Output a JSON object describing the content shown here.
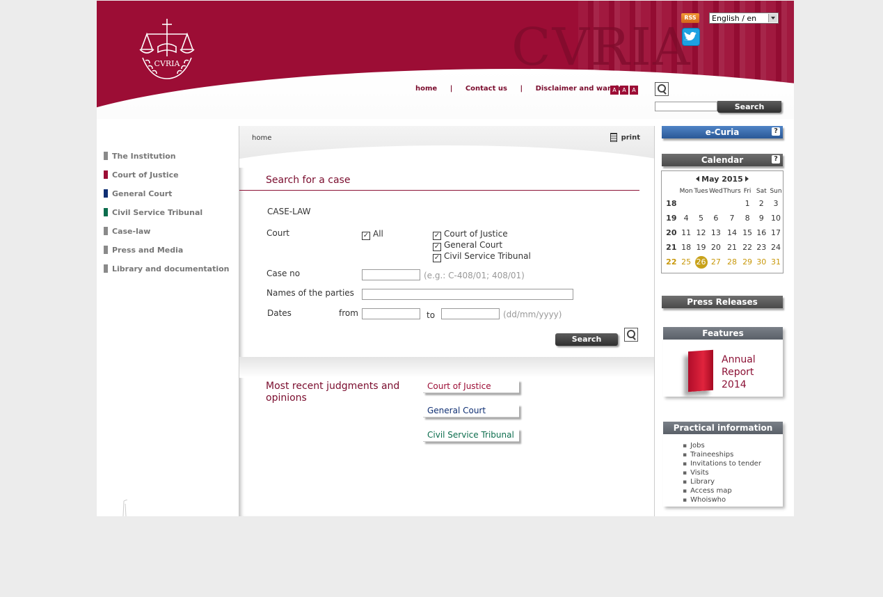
{
  "header": {
    "logo_text": "CVRIA",
    "brand_text": "CVRIA",
    "rss_label": "RSS",
    "language": "English / en",
    "links": [
      "home",
      "Contact us",
      "Disclaimer and warning"
    ],
    "font_size_labels": [
      "A",
      "A",
      "A"
    ],
    "search_button": "Search"
  },
  "left_nav": [
    {
      "label": "The Institution",
      "color": "#8a8a8a"
    },
    {
      "label": "Court of Justice",
      "color": "#9c0d35"
    },
    {
      "label": "General Court",
      "color": "#0f2f73"
    },
    {
      "label": "Civil Service Tribunal",
      "color": "#0c6d4d"
    },
    {
      "label": "Case-law",
      "color": "#8a8a8a"
    },
    {
      "label": "Press and Media",
      "color": "#8a8a8a"
    },
    {
      "label": "Library and documentation",
      "color": "#8a8a8a"
    }
  ],
  "breadcrumb": "home",
  "print_label": "print",
  "search_form": {
    "title": "Search for a case",
    "section": "CASE-LAW",
    "court_label": "Court",
    "court_all": "All",
    "courts": [
      "Court of Justice",
      "General Court",
      "Civil Service Tribunal"
    ],
    "case_no_label": "Case no",
    "case_no_hint": "(e.g.: C-408/01; 408/01)",
    "parties_label": "Names of the parties",
    "dates_label": "Dates",
    "from_label": "from",
    "to_label": "to",
    "date_hint": "(dd/mm/yyyy)",
    "submit_label": "Search"
  },
  "recent": {
    "title_line1": "Most recent judgments and",
    "title_line2": "opinions",
    "buttons": [
      {
        "label": "Court of Justice",
        "color": "#9c0d35"
      },
      {
        "label": "General Court",
        "color": "#0f2f73"
      },
      {
        "label": "Civil Service Tribunal",
        "color": "#0c6d4d"
      }
    ]
  },
  "sidebar": {
    "ecuria": "e-Curia",
    "calendar_title": "Calendar",
    "help": "?",
    "press_releases": "Press Releases",
    "features_title": "Features",
    "features_text": [
      "Annual",
      "Report",
      "2014"
    ],
    "practical_title": "Practical information",
    "practical_items": [
      "Jobs",
      "Traineeships",
      "Invitations to tender",
      "Visits",
      "Library",
      "Access map",
      "Whoiswho"
    ]
  },
  "calendar": {
    "month": "May 2015",
    "weekdays": [
      "Mon",
      "Tues",
      "Wed",
      "Thurs",
      "Fri",
      "Sat",
      "Sun"
    ],
    "weeks": [
      {
        "num": "18",
        "days": [
          "",
          "",
          "",
          "",
          "1",
          "2",
          "3"
        ]
      },
      {
        "num": "19",
        "days": [
          "4",
          "5",
          "6",
          "7",
          "8",
          "9",
          "10"
        ]
      },
      {
        "num": "20",
        "days": [
          "11",
          "12",
          "13",
          "14",
          "15",
          "16",
          "17"
        ]
      },
      {
        "num": "21",
        "days": [
          "18",
          "19",
          "20",
          "21",
          "22",
          "23",
          "24"
        ]
      },
      {
        "num": "22",
        "days": [
          "25",
          "26",
          "27",
          "28",
          "29",
          "30",
          "31"
        ]
      }
    ],
    "today": "26"
  }
}
